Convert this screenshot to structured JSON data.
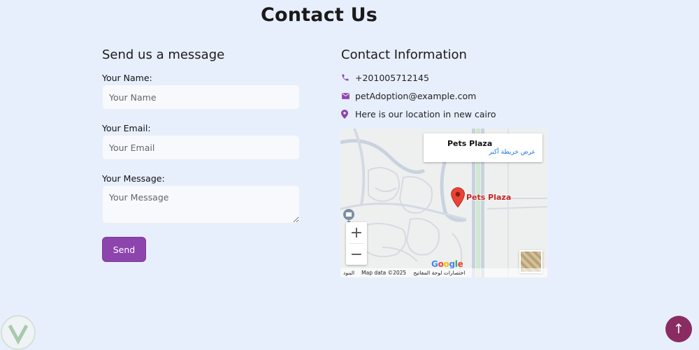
{
  "page": {
    "title": "Contact Us"
  },
  "form": {
    "heading": "Send us a message",
    "name_label": "Your Name:",
    "name_placeholder": "Your Name",
    "email_label": "Your Email:",
    "email_placeholder": "Your Email",
    "message_label": "Your Message:",
    "message_placeholder": "Your Message",
    "send_label": "Send"
  },
  "contact": {
    "heading": "Contact Information",
    "phone": "+201005712145",
    "email": "petAdoption@example.com",
    "location": "Here is our location in new cairo"
  },
  "map": {
    "place_name": "Pets Plaza",
    "view_larger_link": "عرض خريطة أكبر",
    "pin_label": "Pets Plaza",
    "zoom_in": "+",
    "zoom_out": "−",
    "attribution_keyboard": "البنود",
    "attribution_data": "Map data ©2025",
    "attribution_terms": "اختصارات لوحة المفاتيح",
    "google_letters": [
      "G",
      "o",
      "o",
      "g",
      "l",
      "e"
    ]
  },
  "scroll_top": {
    "symbol": "↑"
  },
  "colors": {
    "background": "#e8effc",
    "accent": "#8e44ad",
    "scroll_button": "#8a2c62",
    "pin": "#ea4335"
  },
  "icons": [
    "phone-icon",
    "envelope-icon",
    "location-pin-icon",
    "map-pin-icon",
    "poi-icon",
    "scroll-up-icon",
    "site-logo-icon"
  ]
}
